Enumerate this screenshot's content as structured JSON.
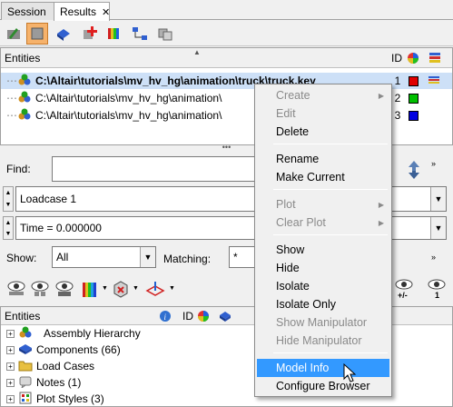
{
  "tabs": [
    {
      "label": "Session"
    },
    {
      "label": "Results",
      "close": "✕"
    }
  ],
  "top_panel": {
    "header": "Entities",
    "col_id": "ID",
    "rows": [
      {
        "path": "C:\\Altair\\tutorials\\mv_hv_hg\\animation\\truck\\truck.key",
        "id": "1",
        "color": "#e00000"
      },
      {
        "path": "C:\\Altair\\tutorials\\mv_hv_hg\\animation\\",
        "id": "2",
        "color": "#00c000"
      },
      {
        "path": "C:\\Altair\\tutorials\\mv_hv_hg\\animation\\",
        "id": "3",
        "color": "#0000e0"
      }
    ]
  },
  "find": {
    "label": "Find:",
    "value": ""
  },
  "loadcase": {
    "value": "Loadcase 1"
  },
  "time": {
    "value": "Time = 0.000000"
  },
  "show": {
    "label": "Show:",
    "value": "All"
  },
  "matching": {
    "label": "Matching:",
    "value": "*"
  },
  "bottom_panel": {
    "header": "Entities",
    "col_id": "ID",
    "rows": [
      {
        "label": "Assembly Hierarchy"
      },
      {
        "label": "Components (66)"
      },
      {
        "label": "Load Cases"
      },
      {
        "label": "Notes (1)"
      },
      {
        "label": "Plot Styles (3)"
      }
    ]
  },
  "context_menu": {
    "items": [
      {
        "label": "Create",
        "disabled": true,
        "submenu": true
      },
      {
        "label": "Edit",
        "disabled": true
      },
      {
        "label": "Delete"
      },
      {
        "label": "Rename"
      },
      {
        "label": "Make Current"
      },
      {
        "label": "Plot",
        "disabled": true,
        "submenu": true
      },
      {
        "label": "Clear Plot",
        "disabled": true,
        "submenu": true
      },
      {
        "label": "Show"
      },
      {
        "label": "Hide"
      },
      {
        "label": "Isolate"
      },
      {
        "label": "Isolate Only"
      },
      {
        "label": "Show Manipulator",
        "disabled": true
      },
      {
        "label": "Hide Manipulator",
        "disabled": true
      },
      {
        "label": "Model Info",
        "highlighted": true
      },
      {
        "label": "Configure Browser"
      }
    ]
  },
  "misc": {
    "plus_minus": "+/-",
    "one": "1"
  }
}
